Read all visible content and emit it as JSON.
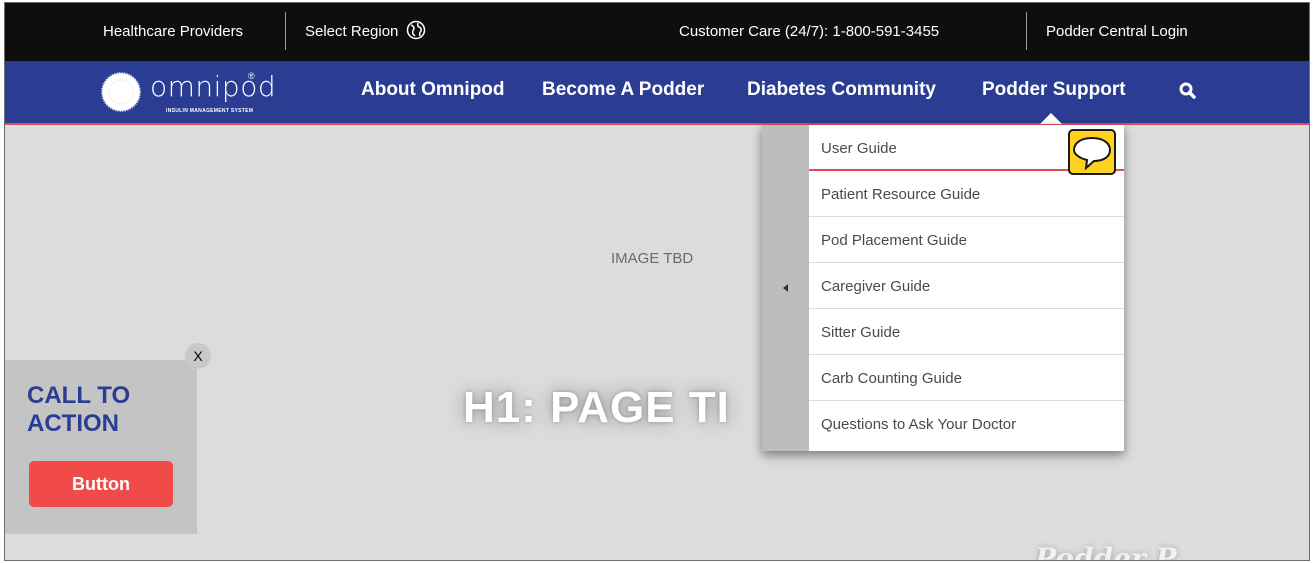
{
  "utility_bar": {
    "healthcare_providers": "Healthcare Providers",
    "select_region": "Select Region",
    "customer_care": "Customer Care (24/7): 1-800-591-3455",
    "login": "Podder Central Login"
  },
  "logo": {
    "wordmark": "omnipod",
    "registered": "®",
    "tagline": "INSULIN MANAGEMENT SYSTEM"
  },
  "nav": {
    "items": [
      "About Omnipod",
      "Become A Podder",
      "Diabetes Community",
      "Podder Support"
    ]
  },
  "hero": {
    "placeholder": "IMAGE TBD",
    "title": "H1: PAGE TI",
    "script_text": "Podder P"
  },
  "cta": {
    "close": "X",
    "title": "CALL TO ACTION",
    "button": "Button"
  },
  "dropdown": {
    "items": [
      "User Guide",
      "Patient Resource Guide",
      "Pod Placement Guide",
      "Caregiver Guide",
      "Sitter Guide",
      "Carb Counting Guide",
      "Questions to Ask Your Doctor"
    ]
  },
  "icons": {
    "globe": "globe-icon",
    "search": "search-icon",
    "chat": "chat-bubble-icon",
    "collapse": "chevron-left-icon"
  },
  "colors": {
    "nav_bg": "#2b3d93",
    "accent_red": "#e04a52",
    "cta_button": "#f04a49",
    "chat_yellow": "#ffd21f"
  }
}
